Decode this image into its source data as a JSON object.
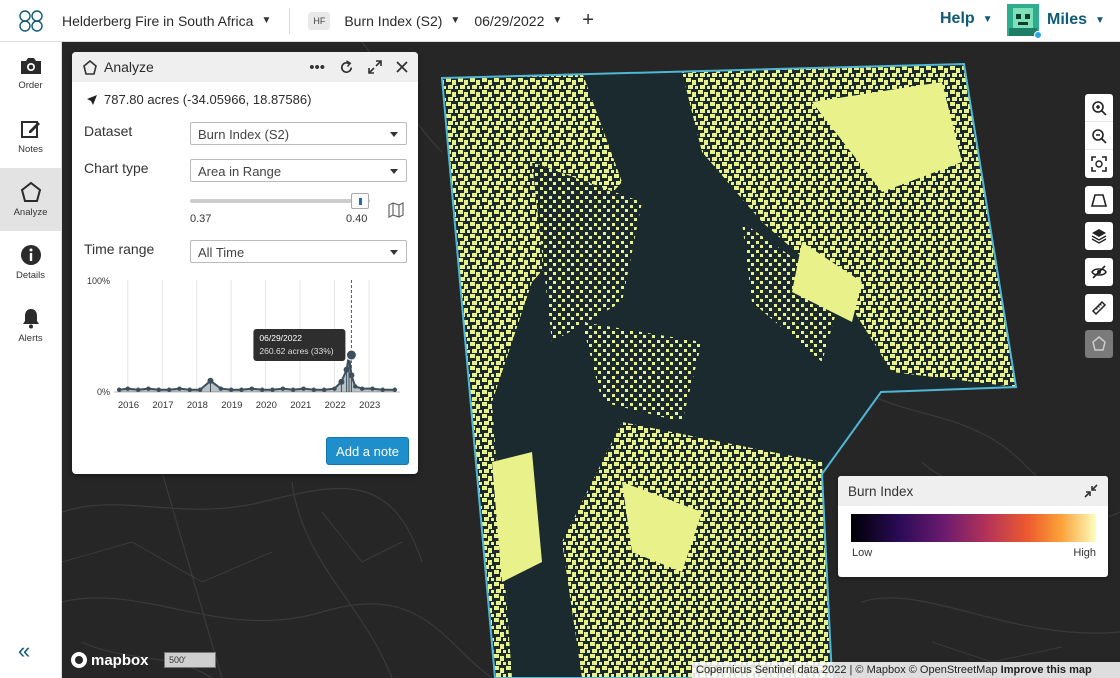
{
  "header": {
    "project_title": "Helderberg Fire in South Africa",
    "dataset_badge": "HF",
    "dataset_name": "Burn Index (S2)",
    "date": "06/29/2022",
    "add_label": "+",
    "help_label": "Help",
    "user_name": "Miles"
  },
  "sidebar": {
    "items": [
      {
        "label": "Order",
        "icon": "camera-icon"
      },
      {
        "label": "Notes",
        "icon": "edit-icon"
      },
      {
        "label": "Analyze",
        "icon": "pentagon-icon"
      },
      {
        "label": "Details",
        "icon": "info-icon"
      },
      {
        "label": "Alerts",
        "icon": "bell-icon"
      }
    ],
    "collapse_label": "«"
  },
  "analyze_panel": {
    "title": "Analyze",
    "location": "787.80 acres (-34.05966, 18.87586)",
    "dataset_label": "Dataset",
    "dataset_value": "Burn Index (S2)",
    "chart_type_label": "Chart type",
    "chart_type_value": "Area in Range",
    "range_min": "0.37",
    "range_max": "0.40",
    "time_range_label": "Time range",
    "time_range_value": "All Time",
    "add_note_label": "Add a note",
    "tooltip_date": "06/29/2022",
    "tooltip_value": "260.62 acres (33%)"
  },
  "chart_data": {
    "type": "line",
    "ylabels": [
      "100%",
      "0%"
    ],
    "ylim": [
      0,
      100
    ],
    "xlim": [
      2015.6,
      2023.9
    ],
    "xticks": [
      "2016",
      "2017",
      "2018",
      "2019",
      "2020",
      "2021",
      "2022",
      "2023"
    ],
    "series": [
      {
        "x": [
          2015.75,
          2016.0,
          2016.3,
          2016.6,
          2016.9,
          2017.2,
          2017.5,
          2017.8,
          2018.1,
          2018.4,
          2018.7,
          2019.0,
          2019.3,
          2019.6,
          2019.9,
          2020.2,
          2020.5,
          2020.8,
          2021.1,
          2021.4,
          2021.7,
          2022.0,
          2022.2,
          2022.35,
          2022.42,
          2022.49,
          2022.6,
          2022.8,
          2023.1,
          2023.4,
          2023.75
        ],
        "y": [
          2,
          3,
          2,
          3,
          2,
          2,
          3,
          2,
          2,
          10,
          3,
          2,
          2,
          3,
          2,
          2,
          3,
          2,
          3,
          2,
          2,
          3,
          9,
          20,
          33,
          15,
          5,
          3,
          3,
          2,
          2
        ]
      }
    ],
    "highlight": {
      "x": 2022.49,
      "y": 33
    }
  },
  "legend": {
    "title": "Burn Index",
    "low": "Low",
    "high": "High"
  },
  "map": {
    "mapbox_label": "mapbox",
    "scale_label": "500′",
    "attribution": "Copernicus Sentinel data 2022 | © Mapbox © OpenStreetMap",
    "attribution_link": "Improve this map"
  },
  "colors": {
    "accent": "#0f5a75",
    "button": "#1f8fcc",
    "aoi_outline": "#4fb6d6",
    "burn_fill": "#e9f28a",
    "map_bg": "#262626"
  }
}
